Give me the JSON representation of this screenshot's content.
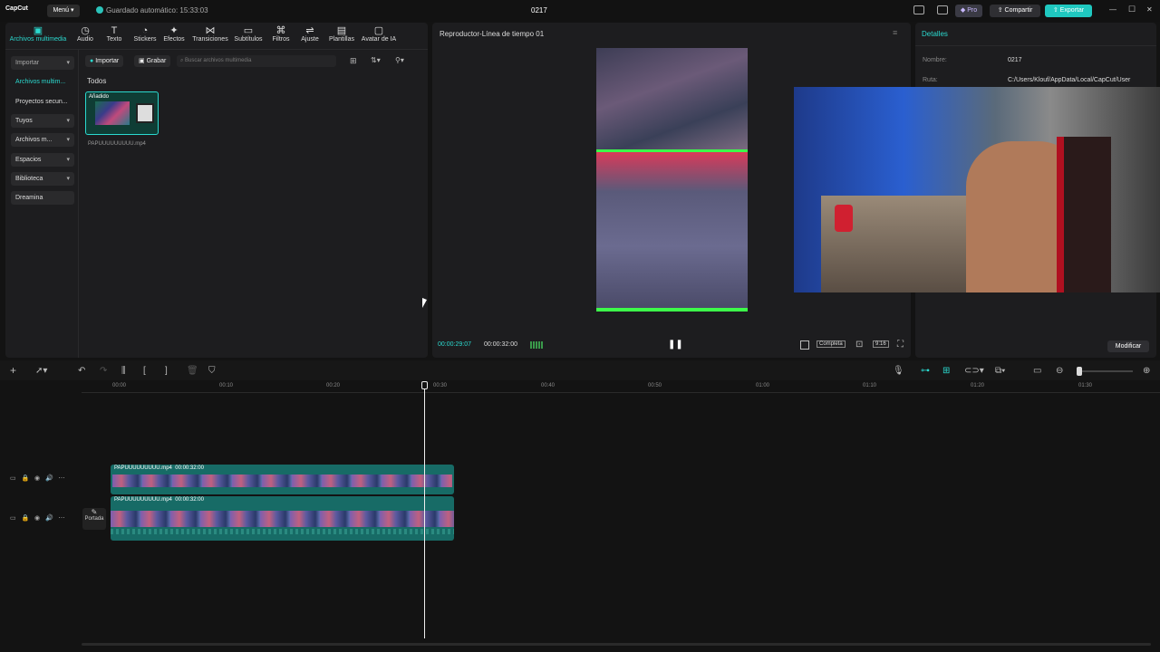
{
  "app": {
    "logo": "CapCut",
    "menu_label": "Menú",
    "autosave": "Guardado automático: 15:33:03",
    "project_name": "0217"
  },
  "titlebar": {
    "pro_label": "Pro",
    "share_label": "Compartir",
    "export_label": "Exportar",
    "minimize": "—",
    "maximize": "☐",
    "close": "✕"
  },
  "toolbar": {
    "tools": [
      {
        "label": "Archivos multimedia",
        "icon": "media-icon"
      },
      {
        "label": "Audio",
        "icon": "audio-icon"
      },
      {
        "label": "Texto",
        "icon": "text-icon"
      },
      {
        "label": "Stickers",
        "icon": "stickers-icon"
      },
      {
        "label": "Efectos",
        "icon": "effects-icon"
      },
      {
        "label": "Transiciones",
        "icon": "transitions-icon"
      },
      {
        "label": "Subtítulos",
        "icon": "subtitles-icon"
      },
      {
        "label": "Filtros",
        "icon": "filters-icon"
      },
      {
        "label": "Ajuste",
        "icon": "adjust-icon"
      },
      {
        "label": "Plantillas",
        "icon": "templates-icon"
      },
      {
        "label": "Avatar de IA",
        "icon": "ai-avatar-icon"
      }
    ]
  },
  "sidebar": {
    "items": [
      {
        "label": "Importar",
        "dropdown": true
      },
      {
        "label": "Archivos multim...",
        "dropdown": false
      },
      {
        "label": "Proyectos secun...",
        "dropdown": false
      },
      {
        "label": "Tuyos",
        "dropdown": true
      },
      {
        "label": "Archivos m...",
        "dropdown": true
      },
      {
        "label": "Espacios",
        "dropdown": true
      },
      {
        "label": "Biblioteca",
        "dropdown": true
      },
      {
        "label": "Dreamina",
        "dropdown": false
      }
    ]
  },
  "media": {
    "import_label": "Importar",
    "record_label": "Grabar",
    "search_placeholder": "Buscar archivos multimedia",
    "filter_label": "Todos",
    "clip": {
      "badge": "Añadido",
      "name": "PAPUUUUUUUUU.mp4"
    }
  },
  "player": {
    "title": "Reproductor-Línea de tiempo 01",
    "current_time": "00:00:29:07",
    "total_time": "00:00:32:00",
    "quality_label": "Completa",
    "ratio_label": "9:16"
  },
  "details": {
    "title": "Detalles",
    "name_label": "Nombre:",
    "name_value": "0217",
    "path_label": "Ruta:",
    "path_value": "C:/Users/Klouf/AppData/Local/CapCut/User",
    "modify_label": "Modificar"
  },
  "timeline": {
    "ruler": [
      "00:00",
      "00:10",
      "00:20",
      "00:30",
      "00:40",
      "00:50",
      "01:00",
      "01:10",
      "01:20",
      "01:30"
    ],
    "tracks": [
      {
        "clip_name": "PAPUUUUUUUUU.mp4",
        "clip_duration": "00:00:32:00"
      },
      {
        "clip_name": "PAPUUUUUUUUU.mp4",
        "clip_duration": "00:00:32:00"
      }
    ],
    "cover_label": "Portada"
  },
  "colors": {
    "accent": "#2bd9cf",
    "export": "#1fc8c0",
    "clip": "#176b66",
    "green_bar": "#3dfc4a"
  }
}
